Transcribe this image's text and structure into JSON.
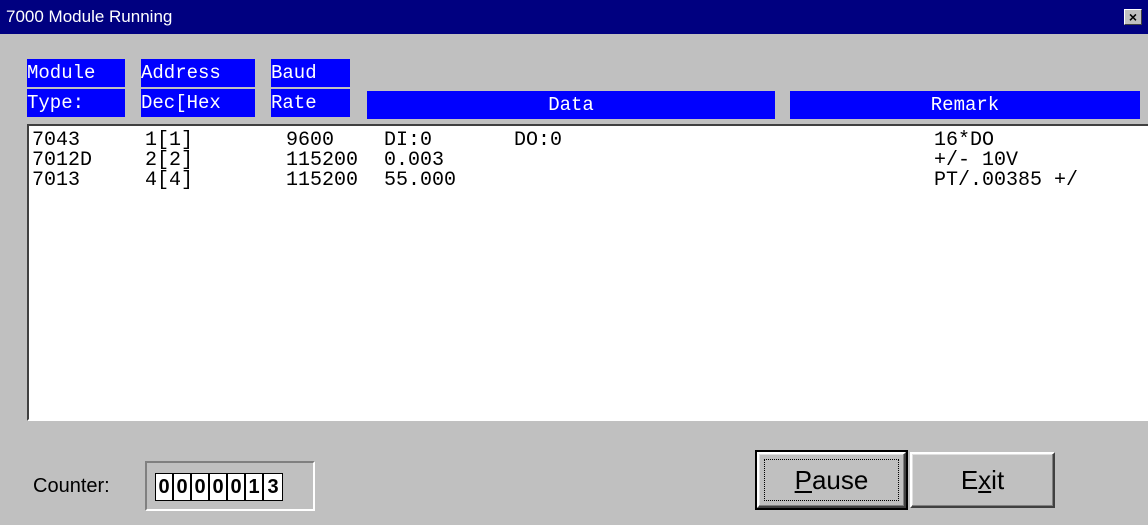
{
  "window": {
    "title": "7000 Module Running",
    "close_glyph": "×"
  },
  "headers": {
    "module_line1": "Module",
    "module_line2": "Type:",
    "address_line1": "Address",
    "address_line2": "Dec[Hex",
    "baud_line1": "Baud",
    "baud_line2": "Rate",
    "data": "Data",
    "remark": "Remark"
  },
  "rows": [
    {
      "module": "7043",
      "address": "1[1]",
      "baud": "9600",
      "data": "DI:0",
      "data2": "DO:0",
      "remark": "16*DO"
    },
    {
      "module": "7012D",
      "address": "2[2]",
      "baud": "115200",
      "data": "0.003",
      "data2": "",
      "remark": "+/- 10V"
    },
    {
      "module": "7013",
      "address": "4[4]",
      "baud": "115200",
      "data": "55.000",
      "data2": "",
      "remark": "PT/.00385 +/"
    }
  ],
  "counter": {
    "label": "Counter:",
    "digits": [
      "0",
      "0",
      "0",
      "0",
      "0",
      "1",
      "3"
    ]
  },
  "buttons": {
    "pause_label_pre": "",
    "pause_label_accel": "P",
    "pause_label_post": "ause",
    "exit_label_pre": "E",
    "exit_label_accel": "x",
    "exit_label_post": "it"
  }
}
